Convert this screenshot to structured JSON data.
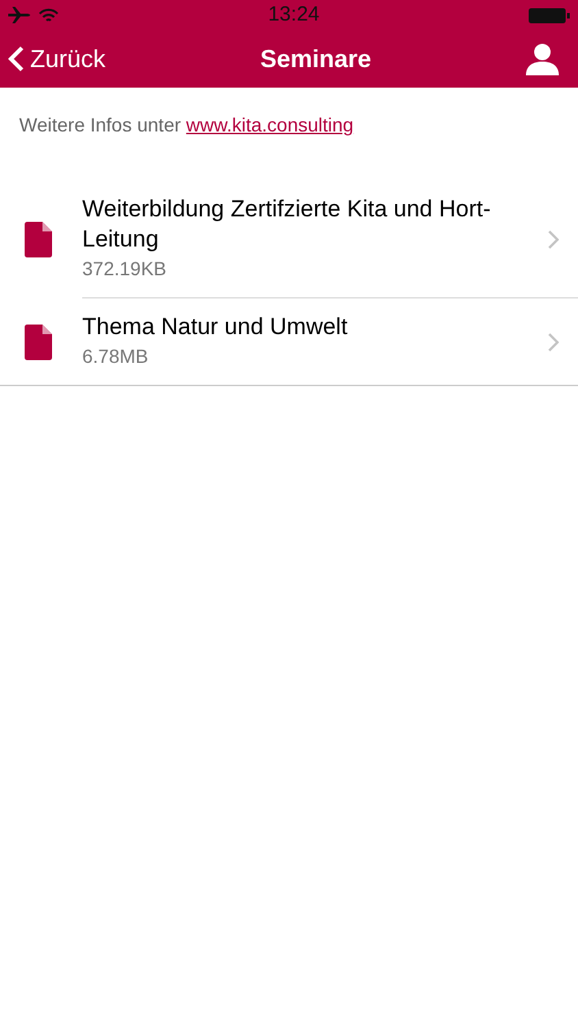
{
  "status_bar": {
    "time": "13:24"
  },
  "nav": {
    "back": "Zurück",
    "title": "Seminare"
  },
  "info": {
    "text": "Weitere Infos unter",
    "link": "www.kita.consulting"
  },
  "files": [
    {
      "name": "Weiterbildung Zertifzierte Kita und Hort-Leitung",
      "size": "372.19KB"
    },
    {
      "name": "Thema Natur und Umwelt",
      "size": "6.78MB"
    }
  ]
}
